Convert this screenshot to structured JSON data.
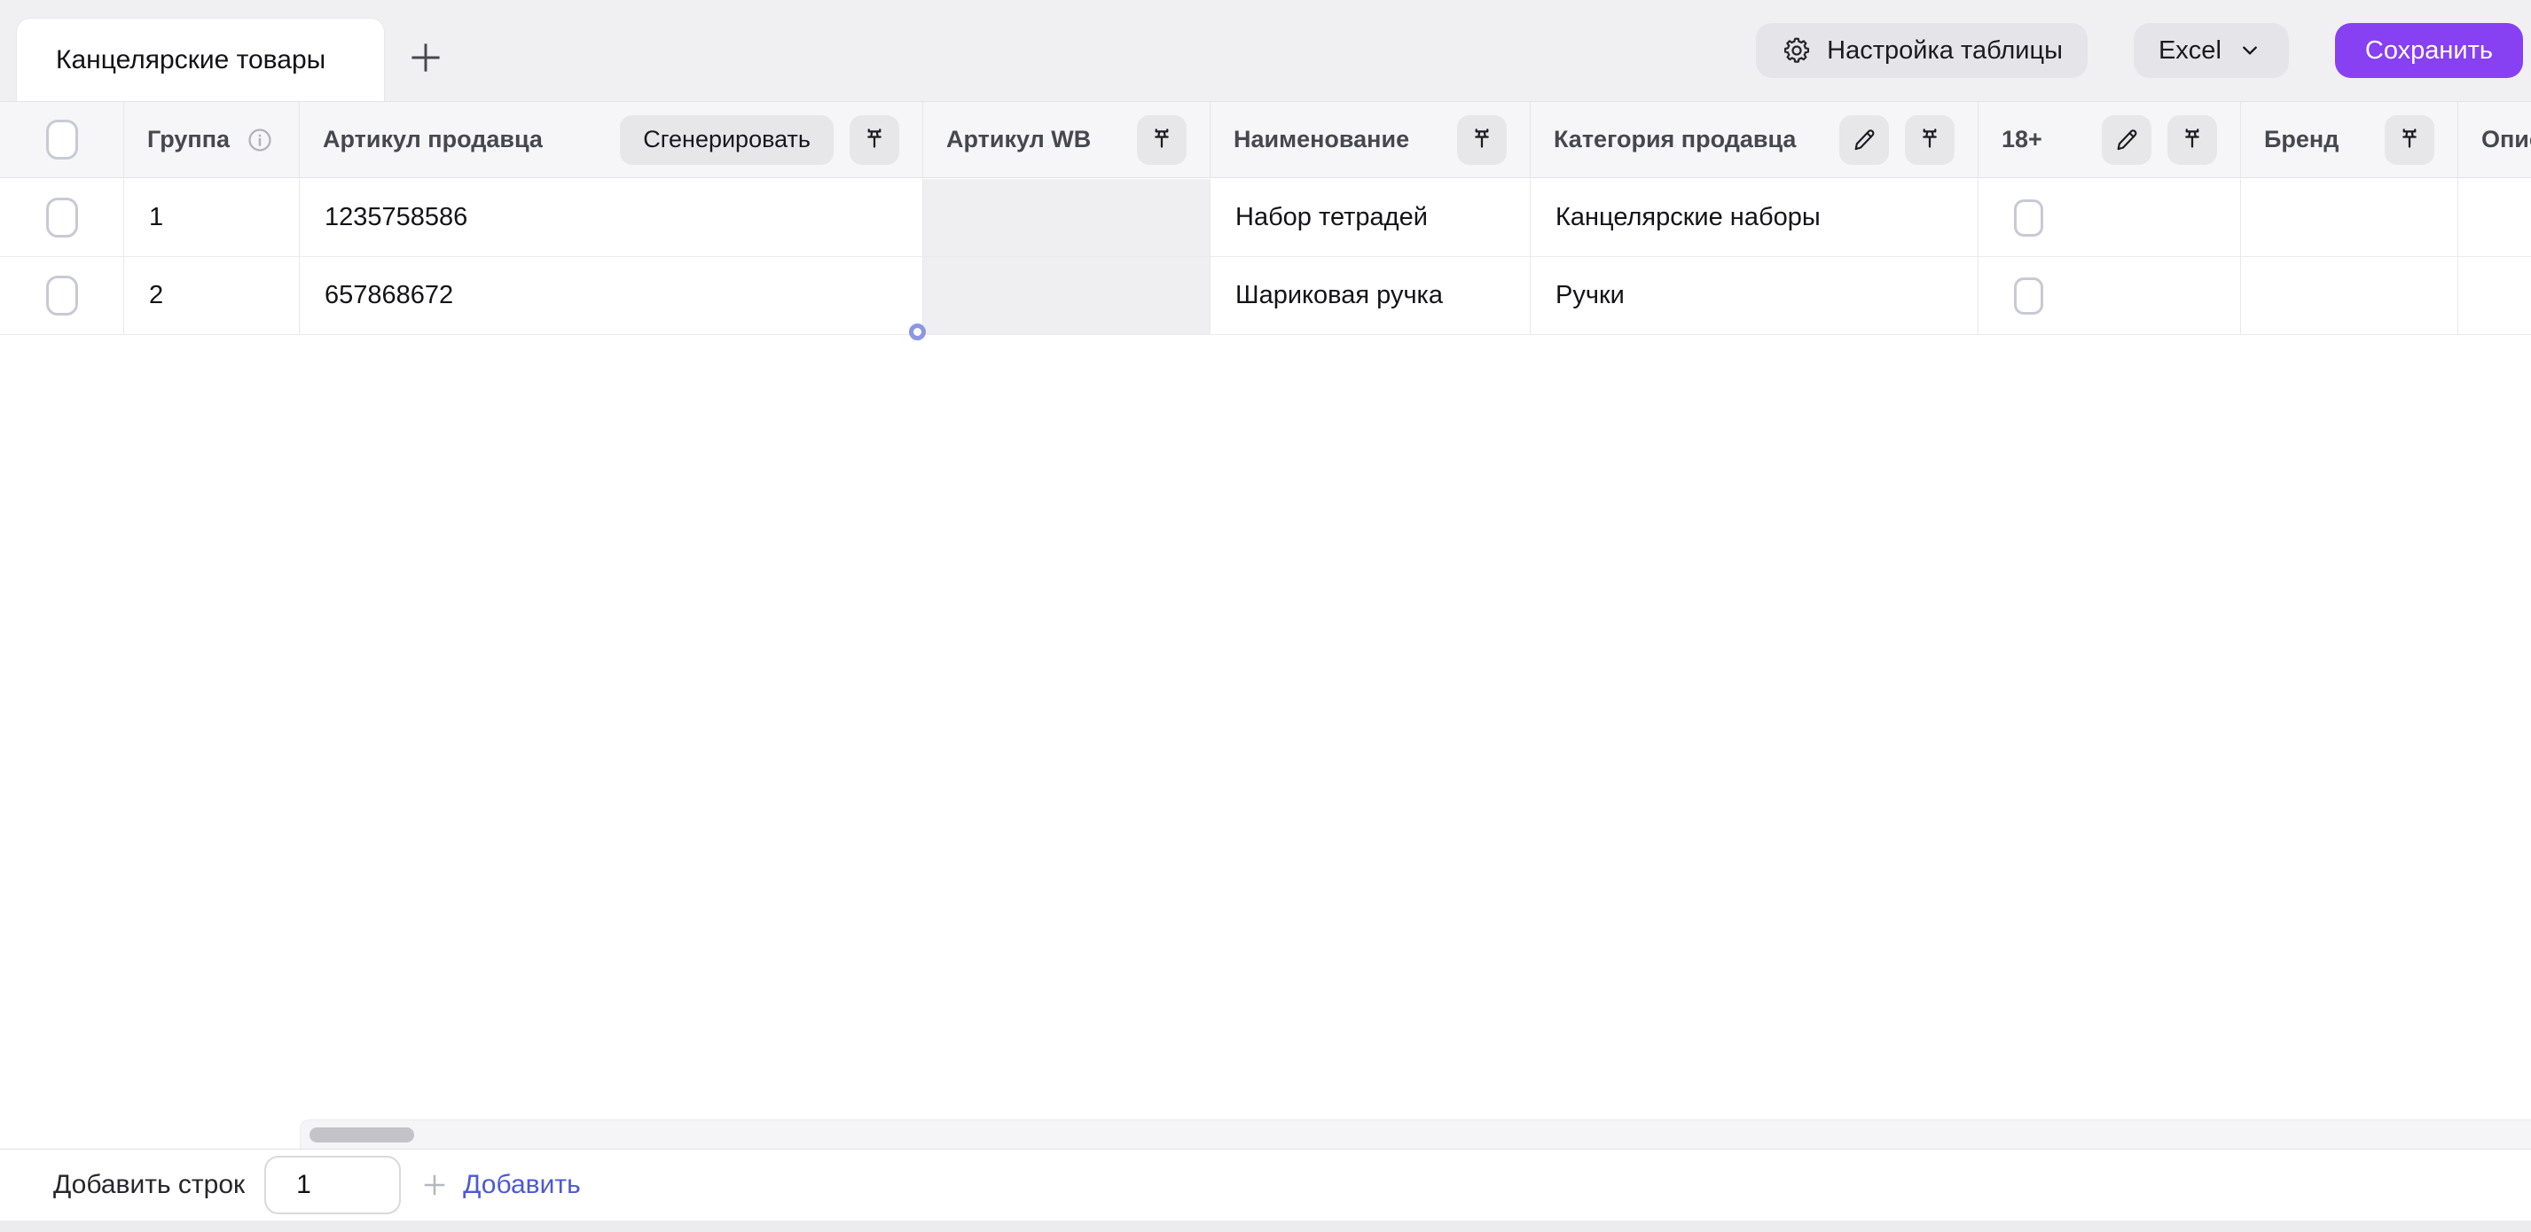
{
  "tabs": {
    "active_label": "Канцелярские товары"
  },
  "toolbar": {
    "settings_label": "Настройка таблицы",
    "excel_label": "Excel",
    "save_label": "Сохранить"
  },
  "table": {
    "columns": [
      {
        "key": "select",
        "label": ""
      },
      {
        "key": "group",
        "label": "Группа",
        "icons": [
          "info-icon"
        ]
      },
      {
        "key": "vendor_code",
        "label": "Артикул продавца",
        "action_label": "Сгенерировать",
        "icons": [
          "pin-icon"
        ]
      },
      {
        "key": "wb_code",
        "label": "Артикул WB",
        "icons": [
          "pin-icon"
        ]
      },
      {
        "key": "name",
        "label": "Наименование",
        "icons": [
          "pin-icon"
        ]
      },
      {
        "key": "category",
        "label": "Категория продавца",
        "icons": [
          "edit-icon",
          "pin-icon"
        ]
      },
      {
        "key": "adult",
        "label": "18+",
        "icons": [
          "edit-icon",
          "pin-icon"
        ]
      },
      {
        "key": "brand",
        "label": "Бренд",
        "icons": [
          "pin-icon"
        ]
      },
      {
        "key": "description",
        "label": "Описание",
        "icons": []
      }
    ],
    "rows": [
      {
        "selected": false,
        "group": "1",
        "vendor_code": "1235758586",
        "wb_code": "",
        "name": "Набор тетрадей",
        "category": "Канцелярские наборы",
        "adult": false,
        "brand": "",
        "description": ""
      },
      {
        "selected": false,
        "group": "2",
        "vendor_code": "657868672",
        "wb_code": "",
        "name": "Шариковая ручка",
        "category": "Ручки",
        "adult": false,
        "brand": "",
        "description": ""
      }
    ]
  },
  "footer": {
    "add_rows_label": "Добавить строк",
    "rows_count_value": "1",
    "add_button_label": "Добавить"
  },
  "colors": {
    "accent_purple": "#8740f2",
    "link_blue": "#4c59d4",
    "header_bg": "#f6f6f8",
    "page_bg": "#f0f0f3",
    "wb_cell_bg": "#efeff1"
  }
}
